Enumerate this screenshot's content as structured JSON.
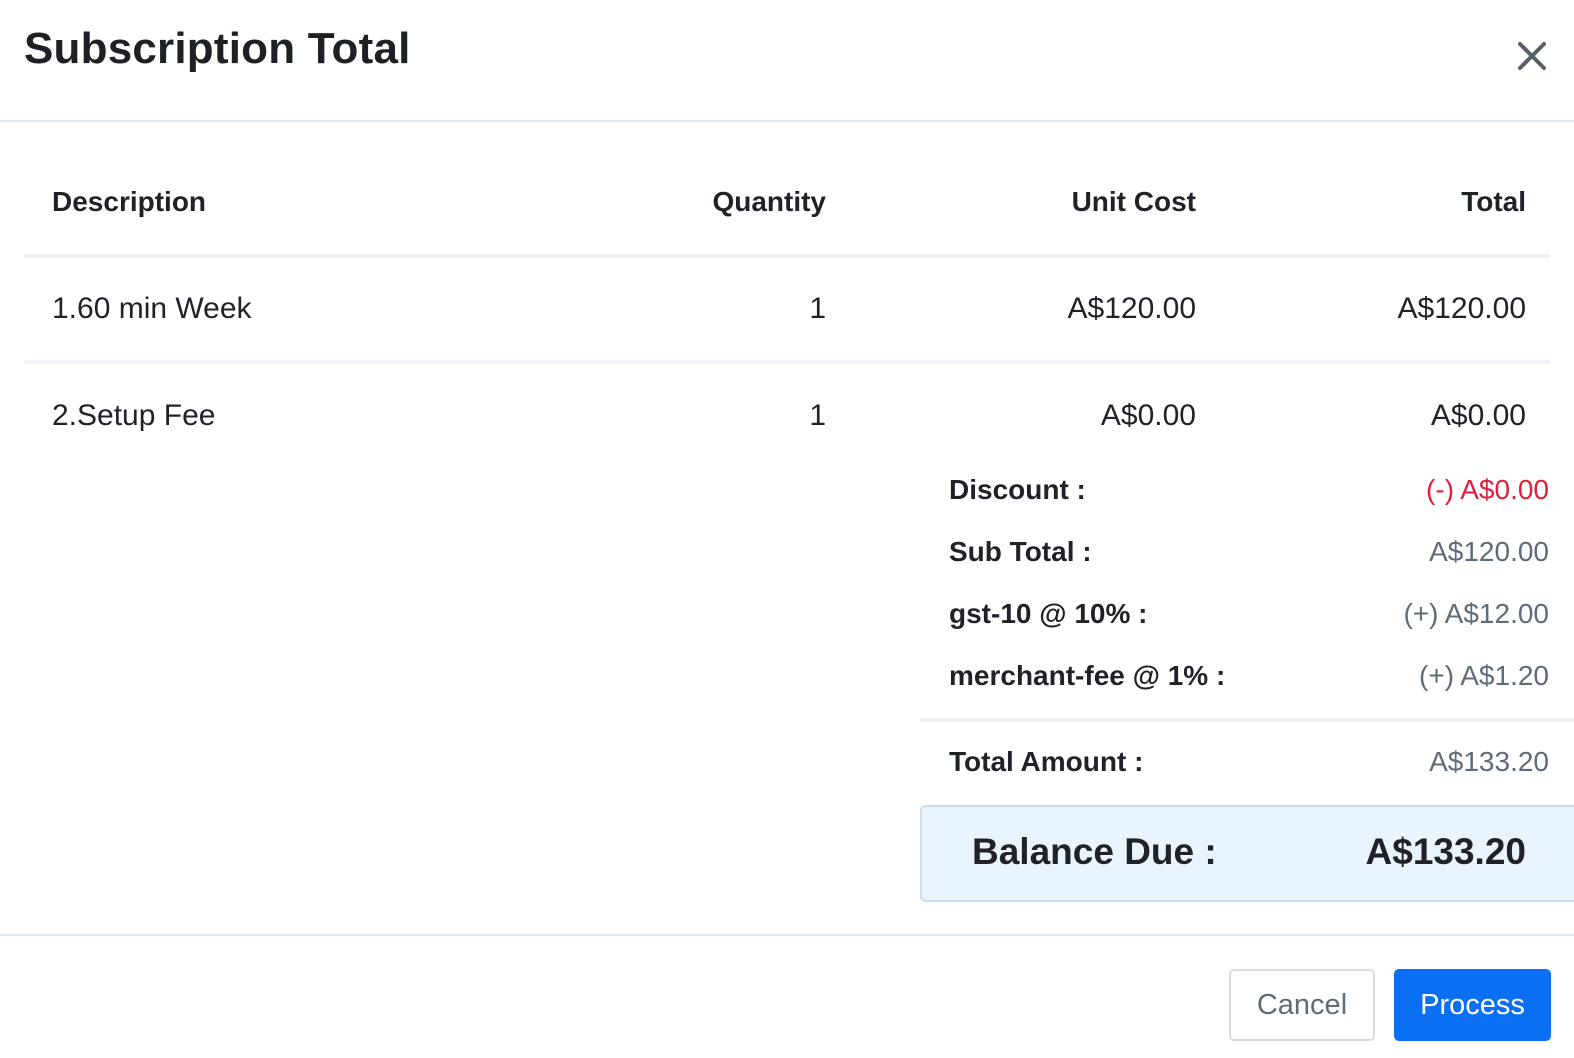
{
  "modal": {
    "title": "Subscription Total",
    "close_icon": "close-icon"
  },
  "table": {
    "headers": {
      "description": "Description",
      "quantity": "Quantity",
      "unit_cost": "Unit Cost",
      "total": "Total"
    },
    "rows": [
      {
        "description": "1.60 min Week",
        "quantity": "1",
        "unit_cost": "A$120.00",
        "total": "A$120.00"
      },
      {
        "description": "2.Setup Fee",
        "quantity": "1",
        "unit_cost": "A$0.00",
        "total": "A$0.00"
      }
    ]
  },
  "summary": {
    "discount": {
      "label": "Discount :",
      "value": "(-) A$0.00"
    },
    "subtotal": {
      "label": "Sub Total :",
      "value": "A$120.00"
    },
    "gst": {
      "label": "gst-10 @ 10% :",
      "value": "(+) A$12.00"
    },
    "merchant_fee": {
      "label": "merchant-fee @ 1% :",
      "value": "(+) A$1.20"
    },
    "total_amount": {
      "label": "Total Amount :",
      "value": "A$133.20"
    },
    "balance_due": {
      "label": "Balance Due :",
      "value": "A$133.20"
    }
  },
  "footer": {
    "cancel_label": "Cancel",
    "process_label": "Process"
  },
  "colors": {
    "primary": "#0a6ff2",
    "negative": "#e0203a",
    "balance_bg": "#eaf4fd"
  }
}
